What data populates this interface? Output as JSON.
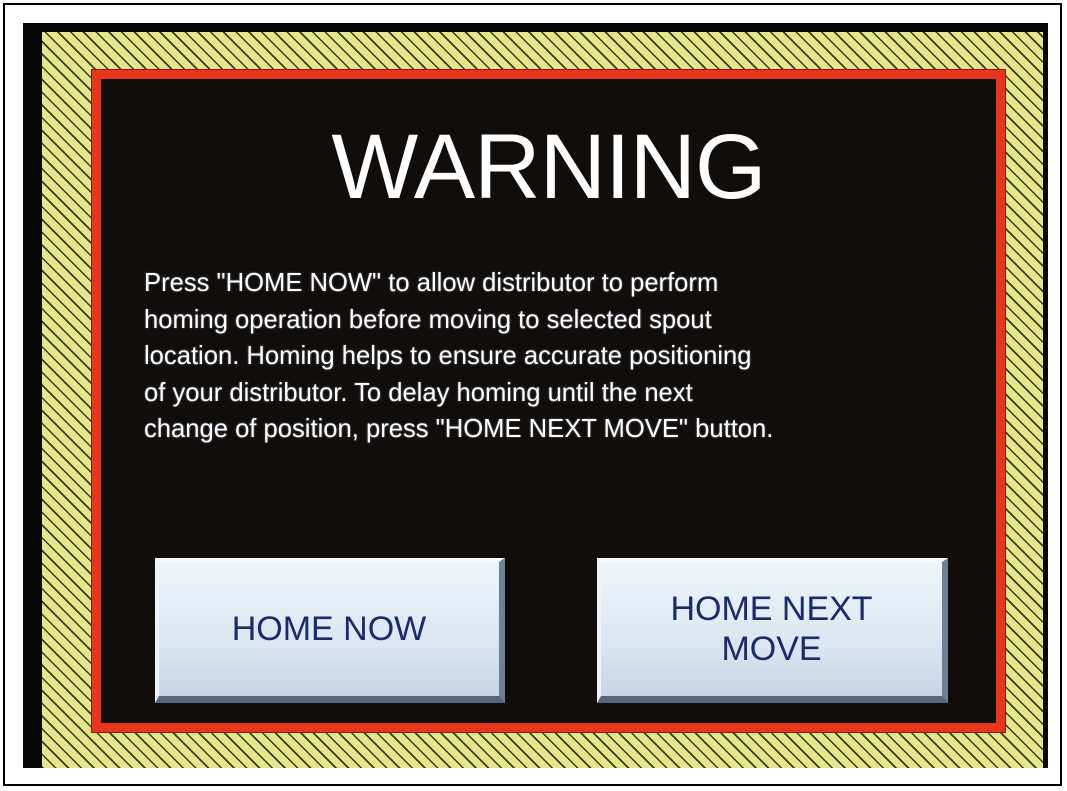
{
  "warning": {
    "title": "WARNING",
    "message": "Press \"HOME NOW\" to allow distributor to perform\nhoming operation before moving to selected spout\nlocation. Homing helps to ensure accurate positioning\nof your distributor. To delay homing until the next\nchange of position, press \"HOME NEXT MOVE\" button."
  },
  "buttons": {
    "home_now": "HOME NOW",
    "home_next_move": "HOME NEXT\nMOVE"
  },
  "colors": {
    "hazard_yellow": "#e4e68a",
    "hazard_stripe": "#3a3a22",
    "warning_red": "#e8361c",
    "panel_background": "#110d0b",
    "button_text": "#1b2a6a"
  }
}
